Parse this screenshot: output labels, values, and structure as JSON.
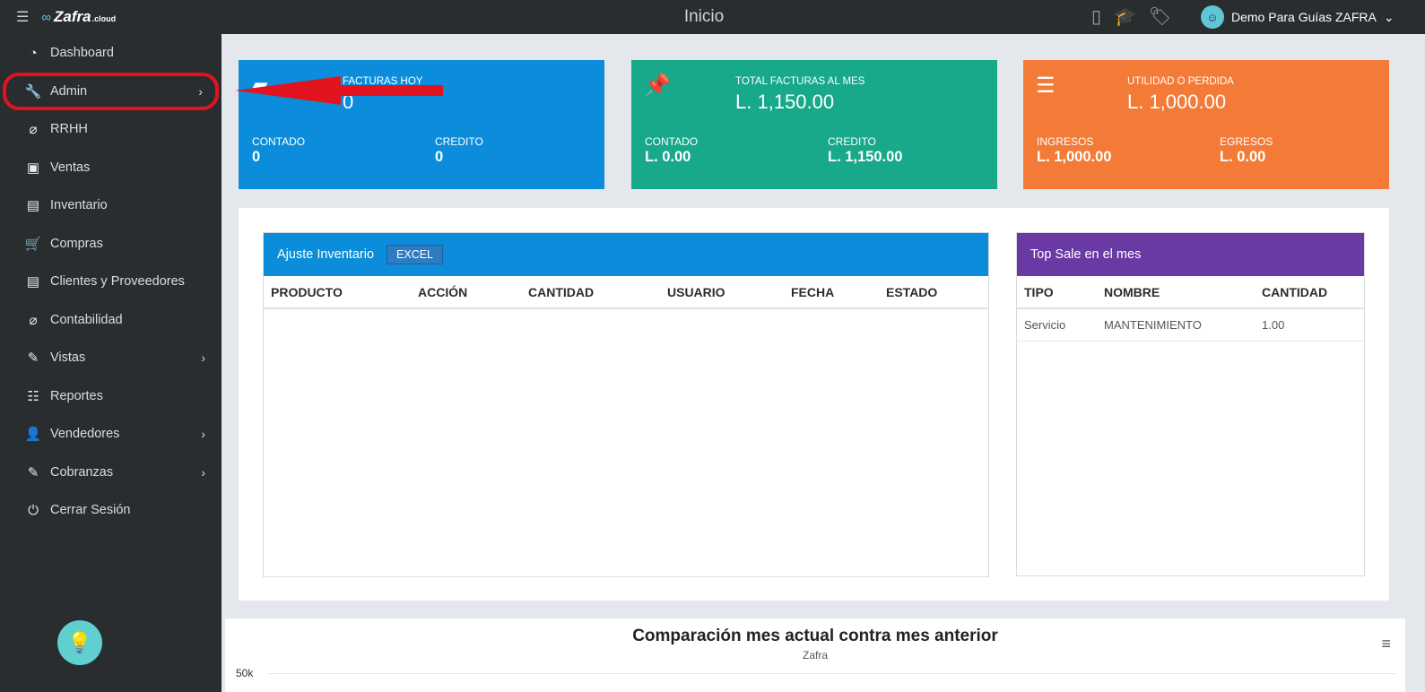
{
  "header": {
    "title": "Inicio",
    "user_name": "Demo Para Guías ZAFRA"
  },
  "logo": {
    "name": "Zafra",
    "suffix": ".cloud"
  },
  "sidebar": {
    "items": [
      {
        "label": "Dashboard",
        "icon": "dashboard-icon"
      },
      {
        "label": "Admin",
        "icon": "wrench-icon"
      },
      {
        "label": "RRHH",
        "icon": "paperclip-icon"
      },
      {
        "label": "Ventas",
        "icon": "money-icon"
      },
      {
        "label": "Inventario",
        "icon": "book-icon"
      },
      {
        "label": "Compras",
        "icon": "cart-icon"
      },
      {
        "label": "Clientes y Proveedores",
        "icon": "book-icon"
      },
      {
        "label": "Contabilidad",
        "icon": "paperclip-icon"
      },
      {
        "label": "Vistas",
        "icon": "edit-icon"
      },
      {
        "label": "Reportes",
        "icon": "list-icon"
      },
      {
        "label": "Vendedores",
        "icon": "user-icon"
      },
      {
        "label": "Cobranzas",
        "icon": "edit-icon"
      },
      {
        "label": "Cerrar Sesión",
        "icon": "power-icon"
      }
    ]
  },
  "cards": {
    "facturas": {
      "title": "FACTURAS HOY",
      "value": "0",
      "left_label": "CONTADO",
      "left_value": "0",
      "right_label": "CREDITO",
      "right_value": "0",
      "color": "#0b8ddb"
    },
    "total": {
      "title": "TOTAL FACTURAS AL MES",
      "value": "L. 1,150.00",
      "left_label": "CONTADO",
      "left_value": "L. 0.00",
      "right_label": "CREDITO",
      "right_value": "L. 1,150.00",
      "color": "#18a88a"
    },
    "utilidad": {
      "title": "UTILIDAD O PERDIDA",
      "value": "L. 1,000.00",
      "left_label": "INGRESOS",
      "left_value": "L. 1,000.00",
      "right_label": "EGRESOS",
      "right_value": "L. 0.00",
      "color": "#f47b37"
    }
  },
  "ajuste": {
    "title": "Ajuste Inventario",
    "excel_label": "EXCEL",
    "columns": [
      "PRODUCTO",
      "ACCIÓN",
      "CANTIDAD",
      "USUARIO",
      "FECHA",
      "ESTADO"
    ]
  },
  "topsale": {
    "title": "Top Sale en el mes",
    "columns": [
      "TIPO",
      "NOMBRE",
      "CANTIDAD"
    ],
    "rows": [
      [
        "Servicio",
        "MANTENIMIENTO",
        "1.00"
      ]
    ]
  },
  "chart": {
    "title": "Comparación mes actual contra mes anterior",
    "subtitle": "Zafra",
    "ytick": "50k"
  }
}
